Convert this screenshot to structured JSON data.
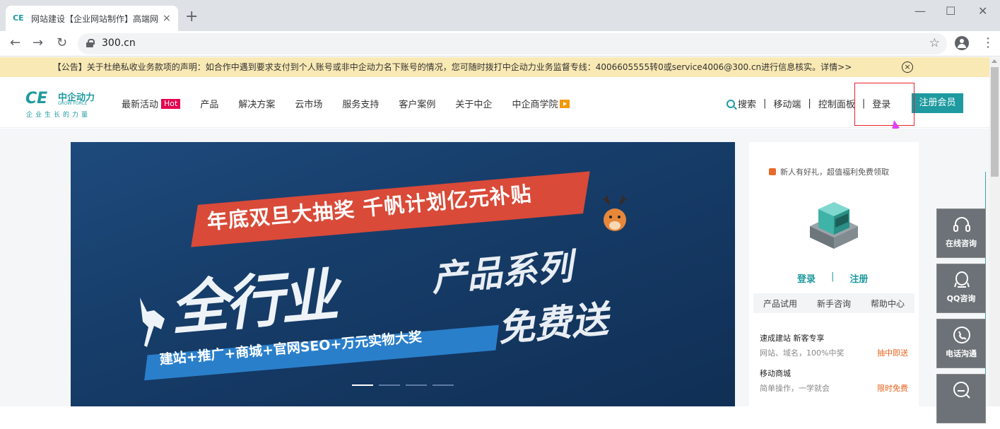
{
  "browser": {
    "tab_title": "网站建设【企业网站制作】高端网",
    "tab_favicon": "CE",
    "tab_close": "×",
    "new_tab": "+",
    "url": "300.cn",
    "minimize": "—",
    "maximize": "☐",
    "close": "✕",
    "back": "←",
    "forward": "→",
    "reload": "↻",
    "star": "☆",
    "menu": "⋮"
  },
  "notice": {
    "text": "【公告】关于杜绝私收业务款项的声明：如合作中遇到要求支付到个人账号或非中企动力名下账号的情况，您可随时拨打中企动力业务监督专线：4006605555转0或service4006@300.cn进行信息核实。详情>>",
    "close_glyph": "×"
  },
  "logo": {
    "mark": "CE",
    "cn": "中企动力",
    "en": "GROW FORCE",
    "slogan": "企业生长的力量"
  },
  "nav": {
    "items": [
      "最新活动",
      "产品",
      "解决方案",
      "云市场",
      "服务支持",
      "客户案例",
      "关于中企",
      "中企商学院"
    ],
    "hot_badge": "Hot"
  },
  "header_right": {
    "search": "搜索",
    "mobile": "移动端",
    "control_panel": "控制面板",
    "login": "登录",
    "register": "注册会员",
    "separator": "|"
  },
  "banner": {
    "ribbon": "年底双旦大抽奖 千帆计划亿元补贴",
    "big": "全行业",
    "sub1": "产品系列",
    "sub2": "免费送",
    "strip": "建站+推广+商城+官网SEO+万元实物大奖"
  },
  "side_card": {
    "gift_text": "新人有好礼，超值福利免费领取",
    "login": "登录",
    "register": "注册",
    "separator": "|",
    "tabs": [
      "产品试用",
      "新手咨询",
      "帮助中心"
    ],
    "promos": [
      {
        "title": "速成建站 新客专享",
        "desc": "网站、域名，100%中奖",
        "tag": "抽中即送"
      },
      {
        "title": "移动商城",
        "desc": "简单操作，一学就会",
        "tag": "限时免费"
      }
    ]
  },
  "float_bar": {
    "items": [
      "在线咨询",
      "QQ咨询",
      "电话沟通",
      ""
    ]
  },
  "colors": {
    "brand": "#1e9aa0",
    "notice_bg": "#f9e9b4",
    "hot": "#e4004f",
    "highlight": "#e8212a",
    "arrow": "#e040fb"
  }
}
